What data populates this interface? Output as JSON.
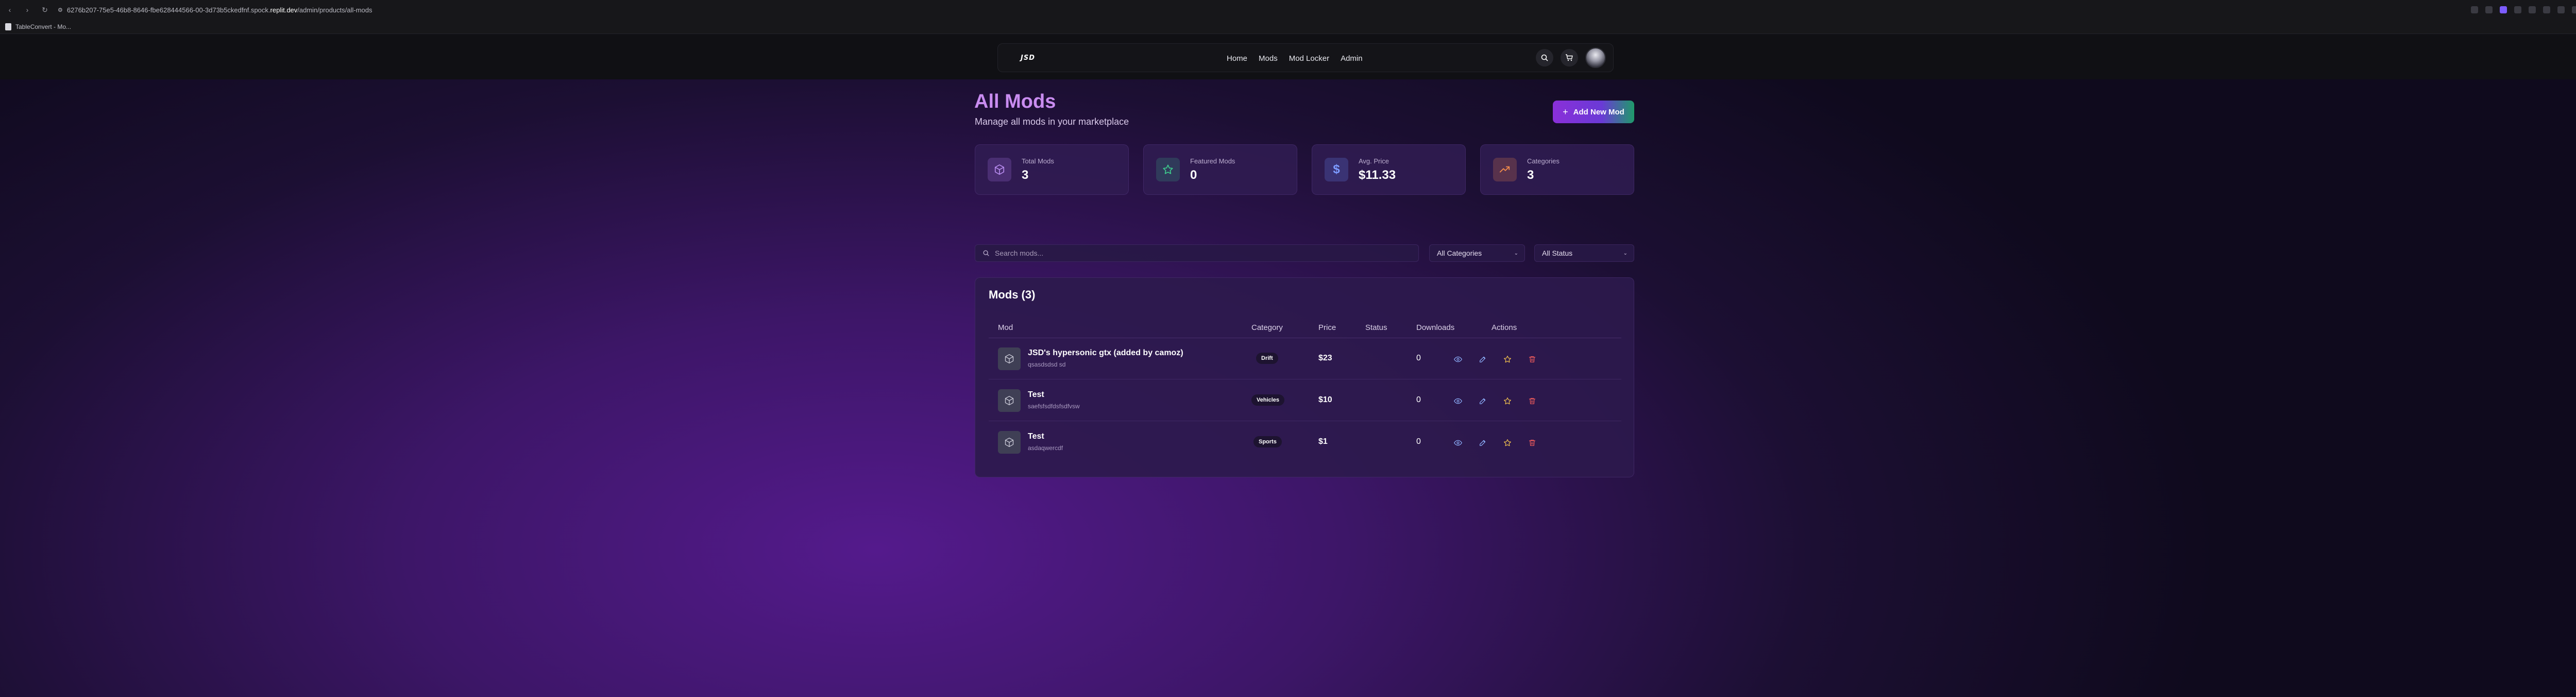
{
  "browser": {
    "url_prefix": "6276b207-75e5-46b8-8646-fbe628444566-00-3d73b5ckedfnf.spock.",
    "url_domain": "replit.dev",
    "url_suffix": "/admin/products/all-mods",
    "bookmark": "TableConvert - Mo..."
  },
  "nav": {
    "logo": "JSD",
    "links": [
      "Home",
      "Mods",
      "Mod Locker",
      "Admin"
    ]
  },
  "header": {
    "title": "All Mods",
    "subtitle": "Manage all mods in your marketplace",
    "add_button": "Add New Mod"
  },
  "stats": [
    {
      "label": "Total Mods",
      "value": "3",
      "icon": "cube-icon",
      "color": "#9b6ad6"
    },
    {
      "label": "Featured Mods",
      "value": "0",
      "icon": "star-icon",
      "color": "#3ecf8e"
    },
    {
      "label": "Avg. Price",
      "value": "$11.33",
      "icon": "dollar-icon",
      "color": "#6a8cff"
    },
    {
      "label": "Categories",
      "value": "3",
      "icon": "trending-up-icon",
      "color": "#f08a4b"
    }
  ],
  "filters": {
    "search_placeholder": "Search mods...",
    "category_selected": "All Categories",
    "status_selected": "All Status"
  },
  "table": {
    "title": "Mods (3)",
    "columns": [
      "Mod",
      "Category",
      "Price",
      "Status",
      "Downloads",
      "Actions"
    ],
    "rows": [
      {
        "name": "JSD's hypersonic gtx (added by camoz)",
        "description": "qsasdsdsd sd",
        "category": "Drift",
        "price": "$23",
        "status": "",
        "downloads": "0"
      },
      {
        "name": "Test",
        "description": "saefsfsdfdsfsdfvsw",
        "category": "Vehicles",
        "price": "$10",
        "status": "",
        "downloads": "0"
      },
      {
        "name": "Test",
        "description": "asdaqwercdf",
        "category": "Sports",
        "price": "$1",
        "status": "",
        "downloads": "0"
      }
    ]
  }
}
